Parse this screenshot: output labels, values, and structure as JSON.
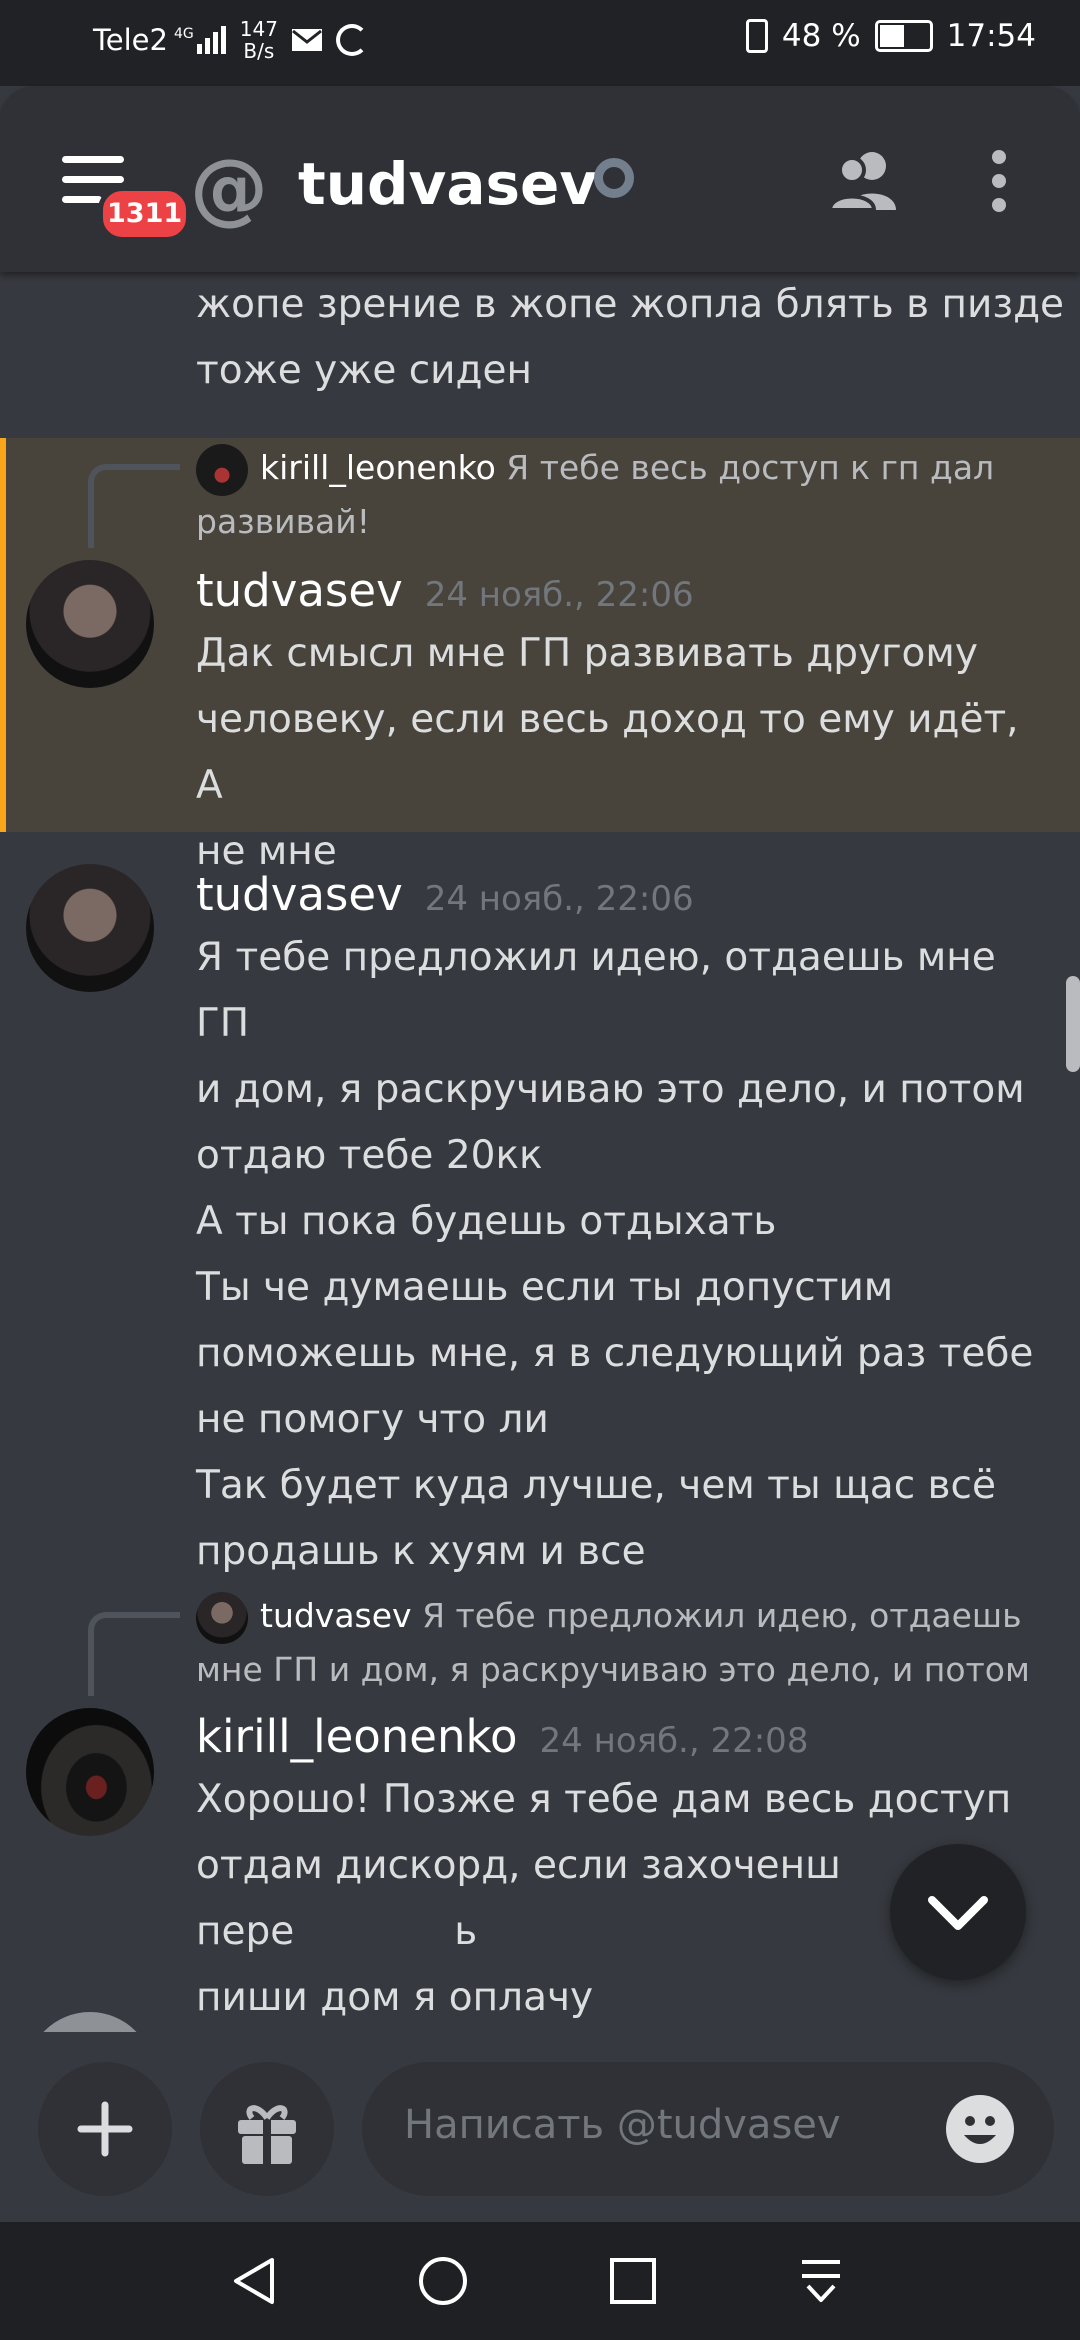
{
  "status_bar": {
    "carrier": "Tele2",
    "network": "4G",
    "net_speed_value": "147",
    "net_speed_unit": "B/s",
    "battery": "48 %",
    "time": "17:54"
  },
  "header": {
    "unread_badge": "1311",
    "channel_symbol": "@",
    "title": "tudvasev"
  },
  "messages": {
    "partial": {
      "line1": "жопе зрение в жопе жопла блять в пизде",
      "line2": "тоже уже сиден"
    },
    "m1": {
      "reply_author": "kirill_leonenko",
      "reply_text_1": "Я тебе весь доступ к гп дал",
      "reply_text_2": "развивай!",
      "author": "tudvasev",
      "time": "24 нояб., 22:06",
      "lines": [
        "Дак смысл мне ГП развивать другому",
        "человеку, если весь доход то ему идёт, А",
        "не мне"
      ]
    },
    "m2": {
      "author": "tudvasev",
      "time": "24 нояб., 22:06",
      "lines": [
        "Я тебе предложил идею, отдаешь мне ГП",
        "и дом, я раскручиваю это дело, и потом",
        "отдаю тебе 20кк",
        "А ты пока будешь отдыхать",
        "Ты че думаешь если ты допустим",
        "поможешь мне, я в следующий раз тебе",
        "не помогу что ли",
        "Так будет куда лучше, чем ты щас всё",
        "продашь к хуям и все"
      ]
    },
    "m3": {
      "reply_author": "tudvasev",
      "reply_text_1": "Я тебе предложил идею, отдаешь",
      "reply_text_2": "мне ГП и дом, я раскручиваю это дело, и потом",
      "author": "kirill_leonenko",
      "time": "24 нояб., 22:08",
      "lines": [
        "Хорошо! Позже я тебе дам весь доступ",
        "отдам дискорд, если захоченш пере",
        "пиши дом я оплачу"
      ],
      "line2_tail": "ь"
    }
  },
  "composer": {
    "placeholder": "Написать @tudvasev"
  },
  "colors": {
    "background": "#36393f",
    "header": "#2f3136",
    "mention_highlight": "#48443c",
    "mention_bar": "#faa61a",
    "badge": "#ed4245"
  },
  "icons": [
    "menu-icon",
    "at-icon",
    "offline-status-icon",
    "members-icon",
    "more-icon",
    "add-icon",
    "gift-icon",
    "emoji-icon",
    "jump-to-present-icon",
    "back-icon",
    "home-icon",
    "recents-icon",
    "notification-shade-icon"
  ]
}
